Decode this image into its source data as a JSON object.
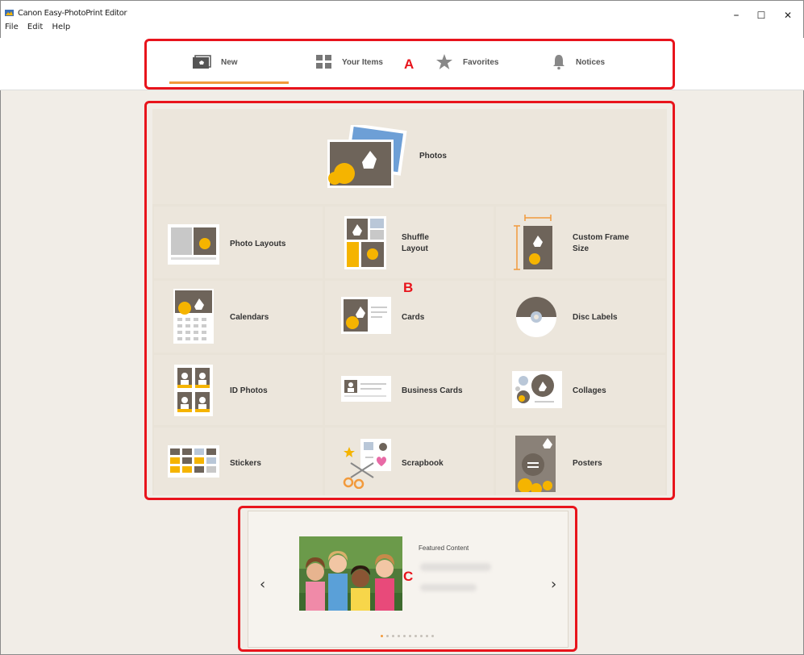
{
  "app": {
    "title": "Canon Easy-PhotoPrint Editor",
    "menu": [
      "File",
      "Edit",
      "Help"
    ]
  },
  "window_controls": {
    "minimize": "–",
    "maximize": "☐",
    "close": "✕"
  },
  "tabs": [
    {
      "label": "New",
      "icon": "new-photo-icon",
      "selected": true
    },
    {
      "label": "Your Items",
      "icon": "grid-icon",
      "selected": false
    },
    {
      "label": "Favorites",
      "icon": "star-icon",
      "selected": false
    },
    {
      "label": "Notices",
      "icon": "bell-icon",
      "selected": false
    }
  ],
  "callouts": {
    "a": "A",
    "b": "B",
    "c": "C"
  },
  "grid": {
    "photos": "Photos",
    "items": [
      {
        "label": "Photo Layouts"
      },
      {
        "label": "Shuffle\nLayout"
      },
      {
        "label": "Custom Frame\nSize"
      },
      {
        "label": "Calendars"
      },
      {
        "label": "Cards"
      },
      {
        "label": "Disc Labels"
      },
      {
        "label": "ID Photos"
      },
      {
        "label": "Business Cards"
      },
      {
        "label": "Collages"
      },
      {
        "label": "Stickers"
      },
      {
        "label": "Scrapbook"
      },
      {
        "label": "Posters"
      }
    ]
  },
  "featured": {
    "title": "Featured Content",
    "prev": "‹",
    "next": "›",
    "dot_count": 10,
    "active_dot": 1
  },
  "colors": {
    "accent": "#f29a3c",
    "callout": "#e8141c"
  }
}
